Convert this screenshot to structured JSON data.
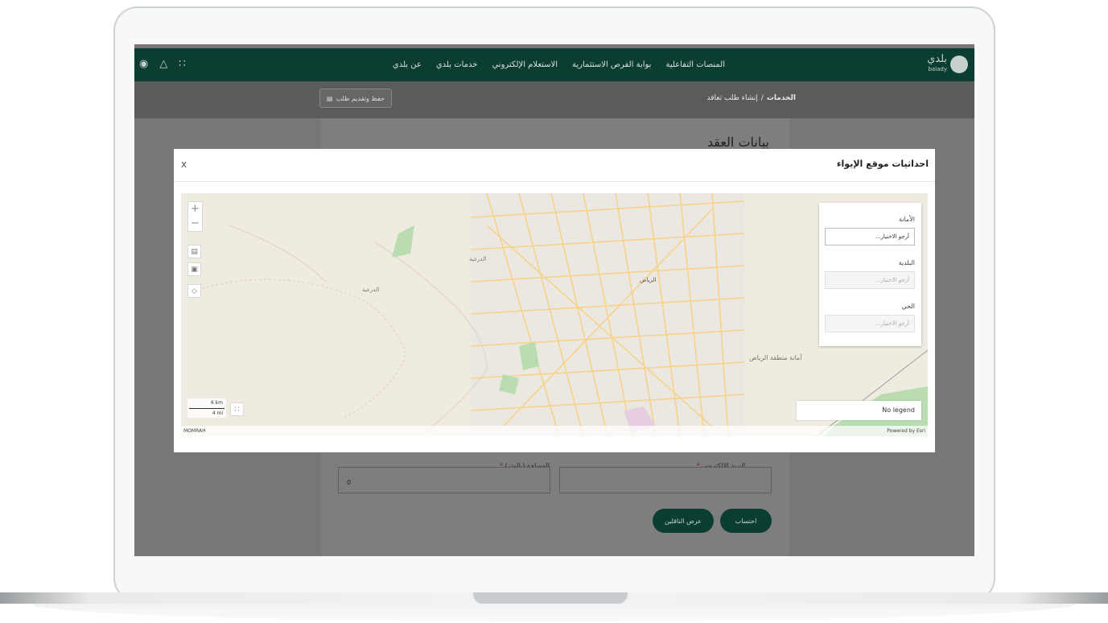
{
  "nav": {
    "items": [
      "عن بلدي",
      "خدمات بلدي",
      "الاستعلام الإلكتروني",
      "بوابة الفرص الاستثمارية",
      "المنصات التفاعلية"
    ],
    "logo_text": "بلدي",
    "logo_sub": "balady"
  },
  "breadcrumb": {
    "root": "الخدمات",
    "sep": "/",
    "current": "إنشاء طلب تعاقد"
  },
  "toolbar": {
    "save_label": "حفظ وتقديم طلب"
  },
  "page": {
    "title": "بيانات العقد"
  },
  "form": {
    "email_label": "البريد الالكتروني",
    "area_label": "المساحة (بالمتر)",
    "area_value": "0",
    "required_mark": "*",
    "calc_button": "احتساب",
    "show_workers_button": "عرض الناقلين"
  },
  "modal": {
    "title": "احداثيات موقع الإيواء",
    "close": "x"
  },
  "map": {
    "filters": [
      {
        "label": "الأمانة",
        "placeholder": "أرجو الاختيار...",
        "enabled": true
      },
      {
        "label": "البلدية",
        "placeholder": "أرجو الاختيار...",
        "enabled": false
      },
      {
        "label": "الحي",
        "placeholder": "أرجو الاختيار...",
        "enabled": false
      }
    ],
    "legend_text": "No legend",
    "attribution_left": "MOMRAH",
    "attribution_right": "Powered by Esri",
    "scale_km": "6 km",
    "scale_mi": "4 mi",
    "labels": {
      "diriyah_1": "الدرعية",
      "diriyah_2": "الدرعية",
      "riyadh": "الرياض",
      "riyadh_region": "أمانة منطقة الرياض"
    }
  }
}
